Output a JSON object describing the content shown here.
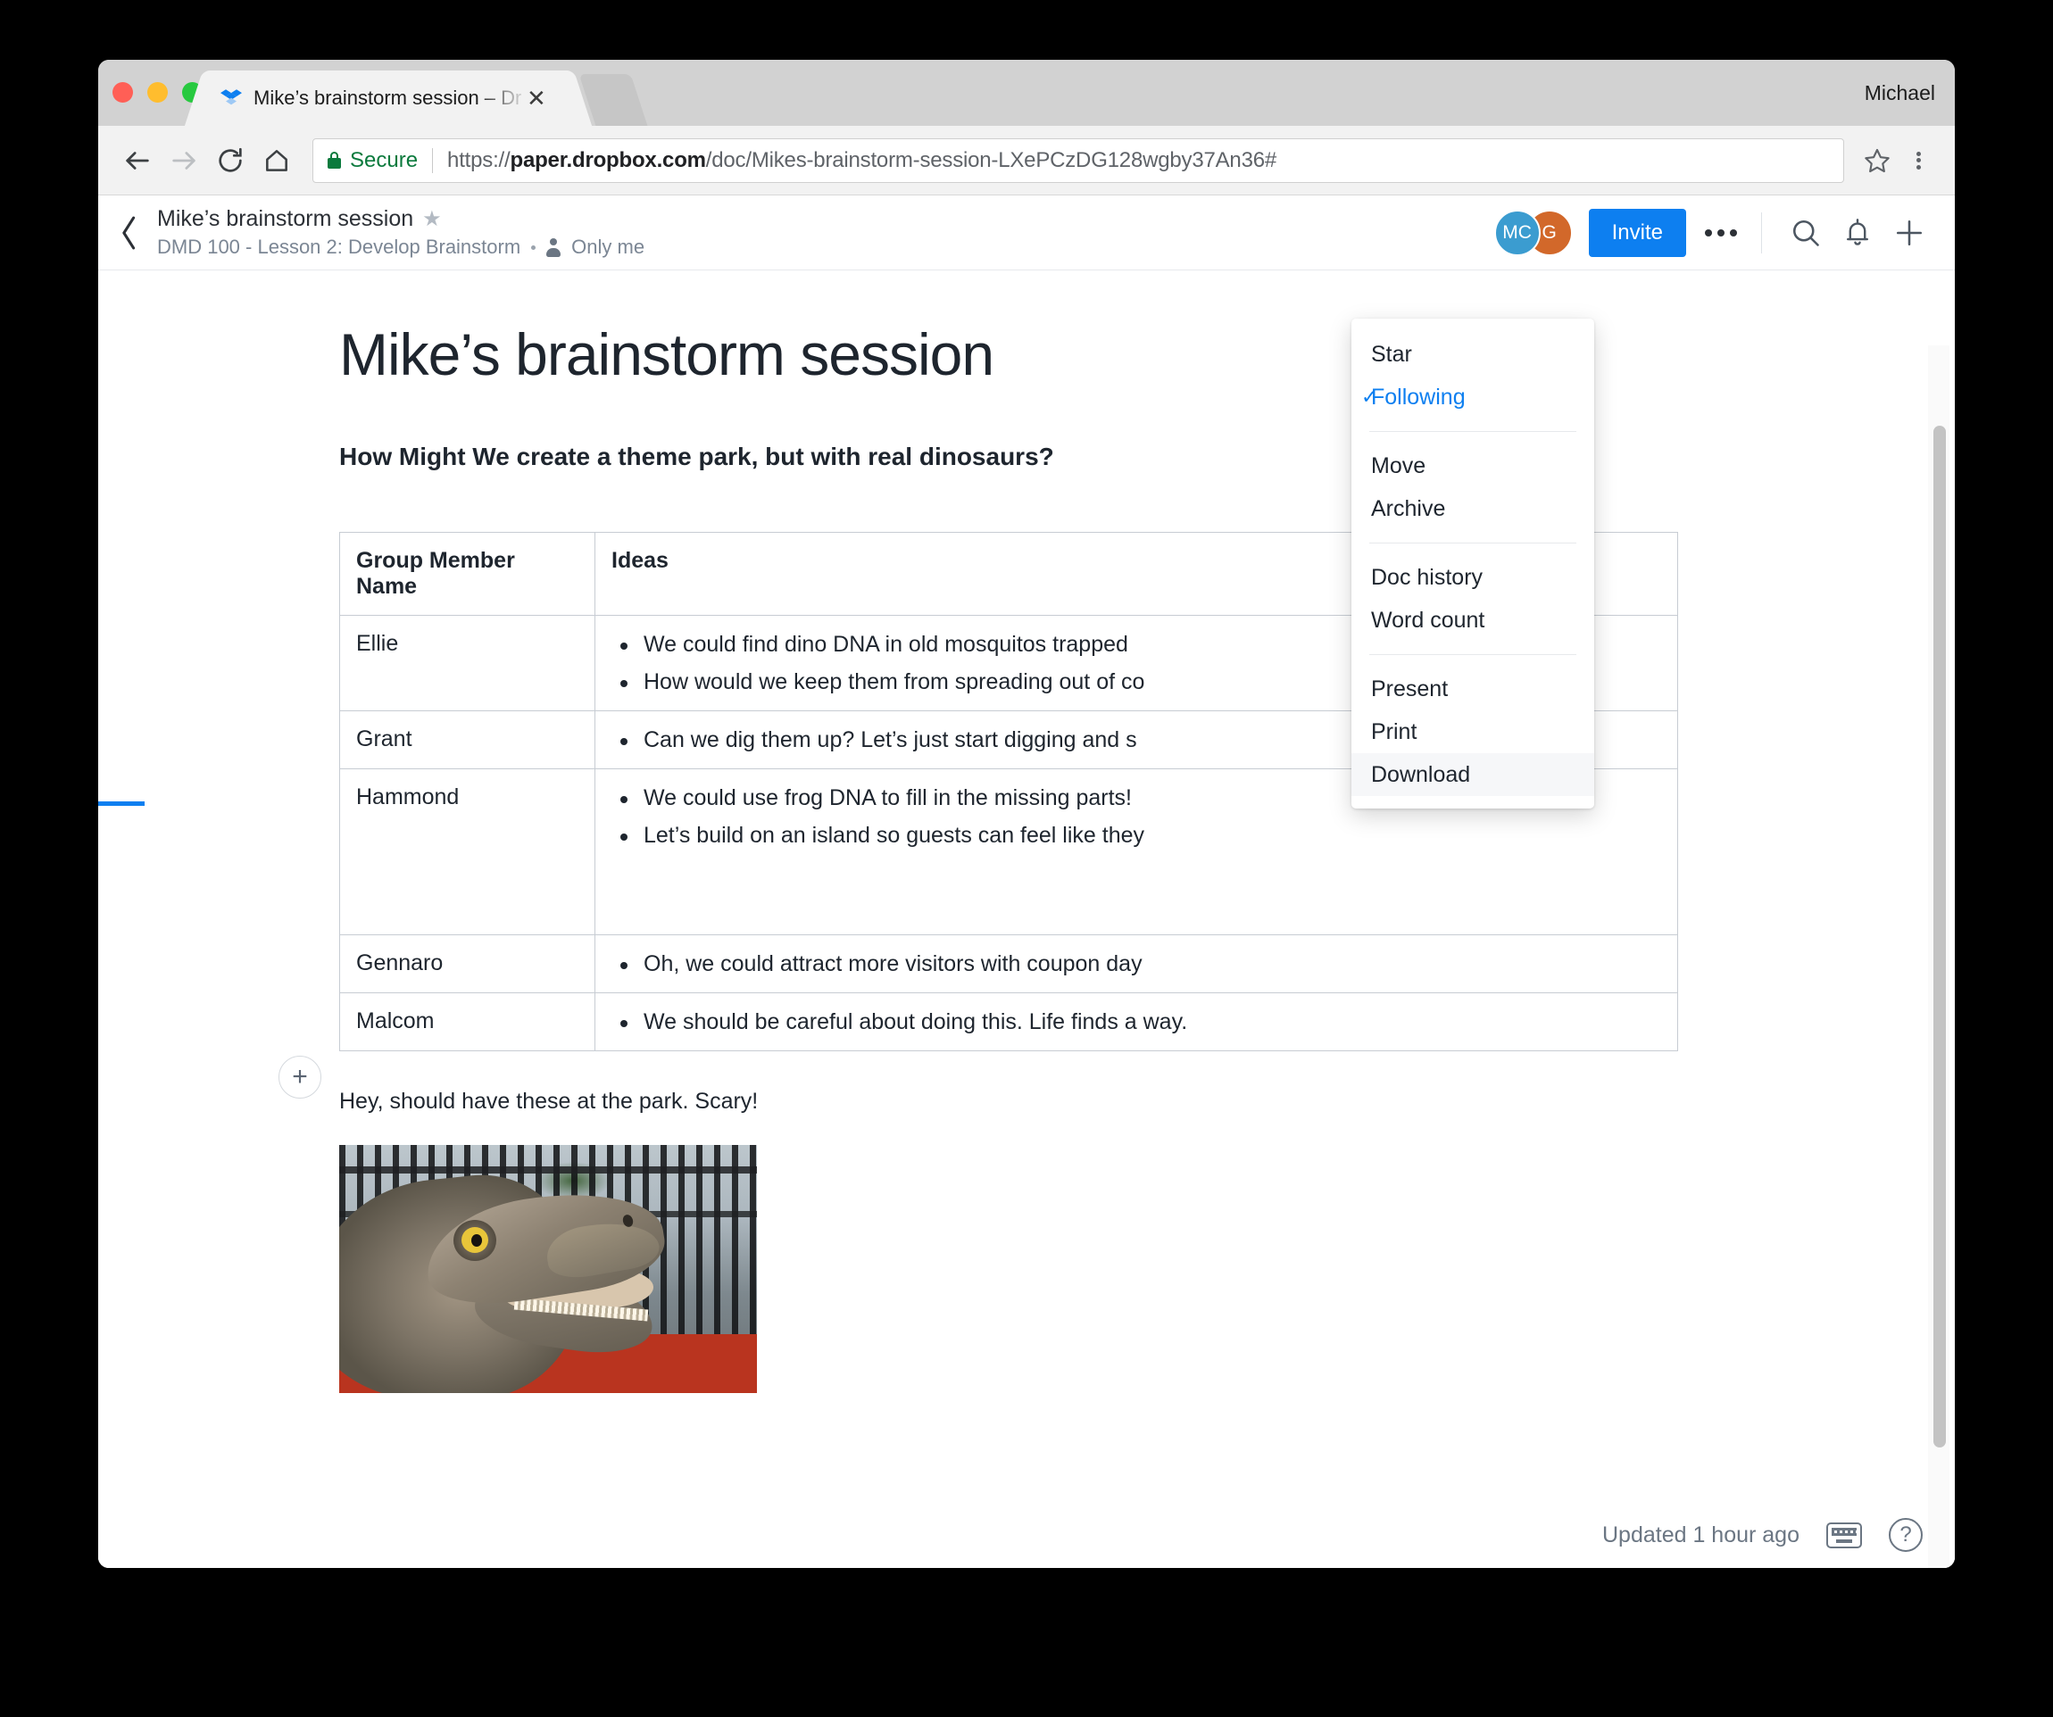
{
  "window": {
    "user_label": "Michael",
    "tab_title": "Mike’s brainstorm session – Dro",
    "tab_close_glyph": "✕",
    "favicon_name": "dropbox-favicon"
  },
  "browser": {
    "security_label": "Secure",
    "url_scheme": "https://",
    "url_host": "paper.dropbox.com",
    "url_path": "/doc/Mikes-brainstorm-session-LXePCzDG128wgby37An36#",
    "back_icon": "back-arrow-icon",
    "forward_icon": "forward-arrow-icon",
    "reload_icon": "reload-icon",
    "home_icon": "home-icon",
    "bookmark_icon": "star-outline-icon",
    "menu_icon": "kebab-menu-icon"
  },
  "app_header": {
    "back_glyph": "‹",
    "doc_title": "Mike’s brainstorm session",
    "star_glyph": "★",
    "folder": "DMD 100 - Lesson 2: Develop Brainstorm",
    "sharing": "Only me",
    "avatars": [
      {
        "initials": "MC",
        "color": "#3b9cd0"
      },
      {
        "initials": "G",
        "color": "#d2682a"
      }
    ],
    "invite_label": "Invite",
    "more_label": "•••",
    "search_icon": "search-icon",
    "bell_icon": "bell-icon",
    "plus_icon": "plus-icon"
  },
  "menu": {
    "items": [
      {
        "label": "Star",
        "checked": false,
        "hover": false
      },
      {
        "label": "Following",
        "checked": true,
        "hover": false
      },
      {
        "separator": true
      },
      {
        "label": "Move",
        "checked": false,
        "hover": false
      },
      {
        "label": "Archive",
        "checked": false,
        "hover": false
      },
      {
        "separator": true
      },
      {
        "label": "Doc history",
        "checked": false,
        "hover": false
      },
      {
        "label": "Word count",
        "checked": false,
        "hover": false
      },
      {
        "separator": true
      },
      {
        "label": "Present",
        "checked": false,
        "hover": false
      },
      {
        "label": "Print",
        "checked": false,
        "hover": false
      },
      {
        "label": "Download",
        "checked": false,
        "hover": true
      }
    ],
    "check_glyph": "✓"
  },
  "document": {
    "heading": "Mike’s brainstorm session",
    "subheading": "How Might We create a theme park, but with real dinosaurs?",
    "insert_plus_glyph": "+",
    "table": {
      "columns": [
        "Group Member Name",
        "Ideas"
      ],
      "rows": [
        {
          "name": "Ellie",
          "ideas": [
            "We could find dino DNA in old mosquitos trapped",
            "How would we keep them from spreading out of co"
          ]
        },
        {
          "name": "Grant",
          "ideas": [
            "Can we dig them up? Let’s just start digging and s"
          ]
        },
        {
          "name": "Hammond",
          "ideas": [
            "We could use frog DNA to fill in the missing parts!",
            "Let’s build on an island so guests can feel like they"
          ]
        },
        {
          "name": "Gennaro",
          "ideas": [
            "Oh, we could attract more visitors with coupon day"
          ]
        },
        {
          "name": "Malcom",
          "ideas": [
            "We should be careful about doing this. Life finds a way."
          ]
        }
      ]
    },
    "caption": "Hey, should have these at the park. Scary!",
    "image_name": "dinosaur-photo"
  },
  "status_bar": {
    "updated": "Updated 1 hour ago",
    "keyboard_icon": "keyboard-shortcuts-icon",
    "help_glyph": "?"
  },
  "colors": {
    "accent_blue": "#0d7ff0",
    "secure_green": "#0b7a3d",
    "text_dark": "#1e252e",
    "text_muted": "#7b8694"
  }
}
